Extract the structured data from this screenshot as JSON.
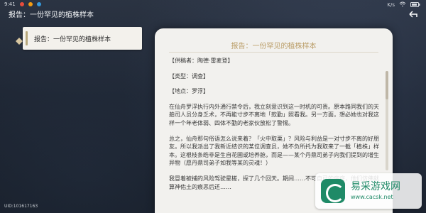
{
  "topbar": {
    "time": "9:41",
    "title": "报告：一份罕见的植株样本",
    "right_text": "K/s"
  },
  "sidebar": {
    "items": [
      {
        "label": "报告：一份罕见的植株样本"
      }
    ]
  },
  "uid": "UID:101617163",
  "panel": {
    "title": "报告：一份罕见的植株样本",
    "meta": {
      "provider": "【供稿者：陶德·雷麦登】",
      "type": "【类型：调查】",
      "location": "【地点：罗浮】"
    },
    "paragraphs": [
      "在仙舟罗浮执行内外通行禁令后，我立刻意识到这一时机的可贵。原本路同我们的天舶司人员分身乏术，不再能寸步不离地「款勤」照看我。另一方面，想必她也对我这样一个年老体弱、四体不勤的老家伙放松了警惕。",
      "总之，仙舟那句俗语怎么说来着？「火中取栗」？风险与利益是一对寸步不离的好朋友。所以我派出了我新近结识的某位调查员，她不负所托为我取来了一截「植株」样本。这根枝条皓非是生自花圃或培养舱，而是——某个丹鼎司弟子向我们提到的增生异物（愿丹鼎司弟子如我等某的灵魂！）",
      "我冒着被捕的风险驾驶星槎，探了几个回天。期间……不可自已的病症，他们仿佛就算神佑土的痕恶后还……"
    ]
  },
  "watermark": {
    "cn": "易采游戏网",
    "en": "www.cacsk.net"
  },
  "colors": {
    "panel_bg": "#f2f1ee",
    "title_gold": "#ba9d67",
    "accent_green": "#1f8a67"
  }
}
